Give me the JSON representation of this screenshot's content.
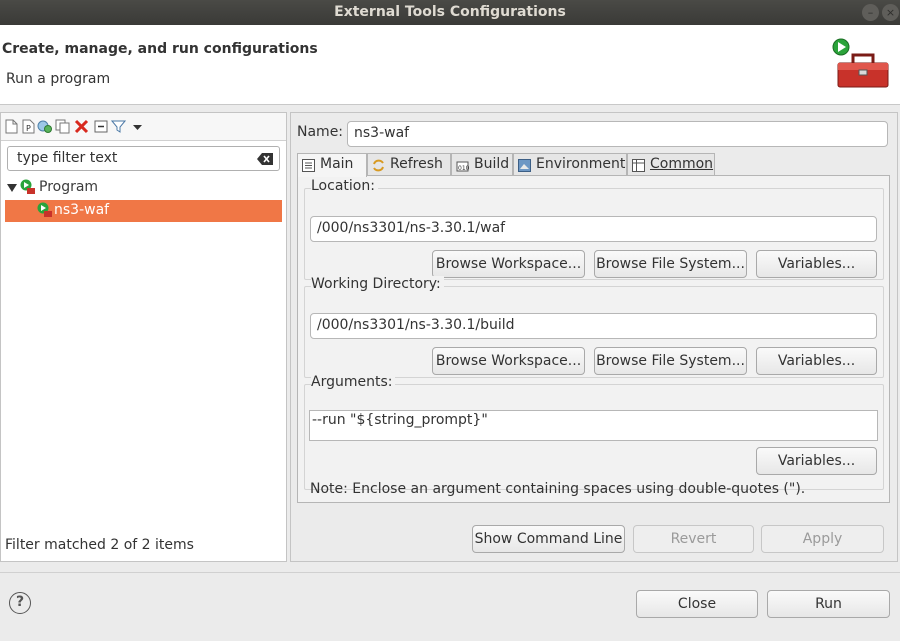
{
  "window": {
    "title": "External Tools Configurations"
  },
  "header": {
    "title": "Create, manage, and run configurations",
    "subtitle": "Run a program",
    "icon": "toolbox-run-icon"
  },
  "left": {
    "toolbar_icons": [
      "new-config-icon",
      "new-prototype-icon",
      "export-icon",
      "duplicate-icon",
      "delete-icon",
      "collapse-all-icon",
      "filter-icon",
      "view-menu-icon"
    ],
    "filter": {
      "value": "type filter text"
    },
    "tree": [
      {
        "label": "Program",
        "type": "category",
        "expanded": true
      },
      {
        "label": "ns3-waf",
        "type": "config",
        "selected": true
      }
    ],
    "status": "Filter matched 2 of 2 items"
  },
  "right": {
    "name_label": "Name:",
    "name_value": "ns3-waf",
    "tabs": [
      {
        "label": "Main",
        "icon": "main-tab-icon",
        "active": true
      },
      {
        "label": "Refresh",
        "icon": "refresh-icon"
      },
      {
        "label": "Build",
        "icon": "build-icon"
      },
      {
        "label": "Environment",
        "icon": "environment-icon"
      },
      {
        "label": "Common",
        "icon": "common-icon"
      }
    ],
    "location": {
      "label": "Location:",
      "value": "/000/ns3301/ns-3.30.1/waf",
      "browse_workspace": "Browse Workspace...",
      "browse_fs": "Browse File System...",
      "variables": "Variables..."
    },
    "working_dir": {
      "label": "Working Directory:",
      "value": "/000/ns3301/ns-3.30.1/build",
      "browse_workspace": "Browse Workspace...",
      "browse_fs": "Browse File System...",
      "variables": "Variables..."
    },
    "arguments": {
      "label": "Arguments:",
      "value": "--run \"${string_prompt}\"",
      "variables": "Variables...",
      "note": "Note: Enclose an argument containing spaces using double-quotes (\")."
    },
    "show_command_line": "Show Command Line",
    "revert": "Revert",
    "apply": "Apply"
  },
  "footer": {
    "help": "?",
    "close": "Close",
    "run": "Run"
  },
  "colors": {
    "selection": "#f07746",
    "titlebar": "#3e3e3b"
  }
}
